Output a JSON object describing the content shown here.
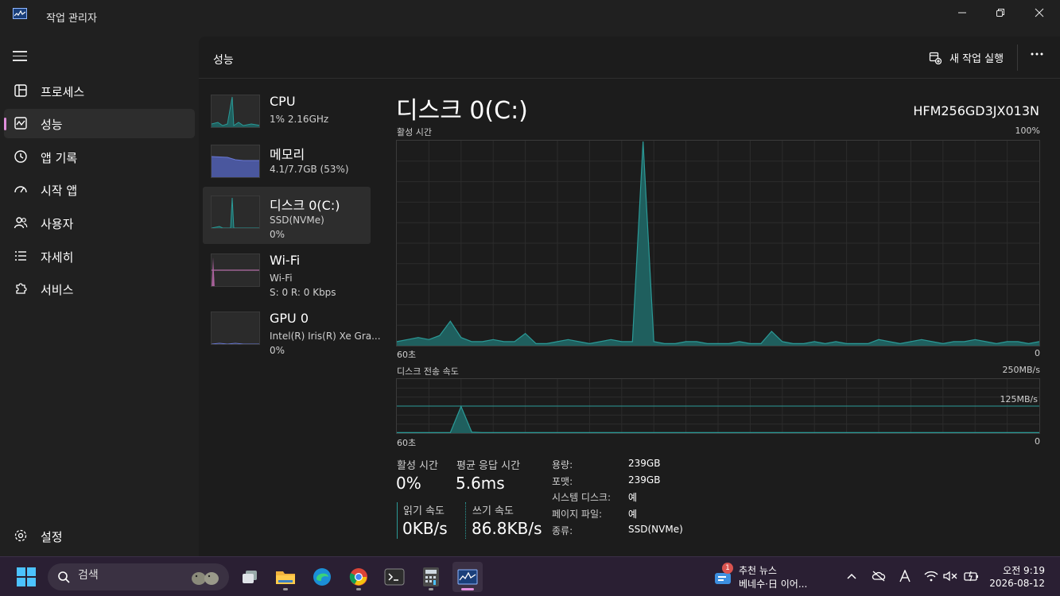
{
  "window": {
    "title": "작업 관리자"
  },
  "sidebar": {
    "items": [
      {
        "label": "프로세스",
        "icon": "grid-icon"
      },
      {
        "label": "성능",
        "icon": "pulse-icon"
      },
      {
        "label": "앱 기록",
        "icon": "history-icon"
      },
      {
        "label": "시작 앱",
        "icon": "speedometer-icon"
      },
      {
        "label": "사용자",
        "icon": "users-icon"
      },
      {
        "label": "자세히",
        "icon": "list-icon"
      },
      {
        "label": "서비스",
        "icon": "puzzle-icon"
      }
    ],
    "settings_label": "설정"
  },
  "header": {
    "title": "성능",
    "new_task_label": "새 작업 실행"
  },
  "devices": [
    {
      "name": "CPU",
      "sub1": "1% 2.16GHz",
      "sub2": "",
      "color": "#2b9a97"
    },
    {
      "name": "메모리",
      "sub1": "4.1/7.7GB (53%)",
      "sub2": "",
      "color": "#6a79d6"
    },
    {
      "name": "디스크 0(C:)",
      "sub1": "SSD(NVMe)",
      "sub2": "0%",
      "color": "#2b9a97"
    },
    {
      "name": "Wi-Fi",
      "sub1": "Wi-Fi",
      "sub2": "S: 0 R: 0 Kbps",
      "color": "#d67fc4"
    },
    {
      "name": "GPU 0",
      "sub1": "Intel(R) Iris(R) Xe Gra...",
      "sub2": "0%",
      "color": "#6a79d6"
    }
  ],
  "detail": {
    "title": "디스크 0(C:)",
    "model": "HFM256GD3JX013N",
    "active_time_graph": {
      "label": "활성 시간",
      "max_label": "100%",
      "x_left": "60초",
      "x_right": "0",
      "values": [
        2,
        3,
        4,
        3,
        5,
        12,
        4,
        2,
        2,
        3,
        2,
        2,
        6,
        1,
        1,
        2,
        3,
        2,
        1,
        2,
        3,
        2,
        2,
        100,
        2,
        1,
        1,
        2,
        2,
        1,
        1,
        1,
        2,
        1,
        1,
        7,
        2,
        1,
        1,
        2,
        1,
        2,
        1,
        1,
        1,
        3,
        2,
        1,
        2,
        3,
        2,
        1,
        2,
        2,
        3,
        2,
        1,
        2,
        2,
        1,
        2
      ]
    },
    "transfer_graph": {
      "label": "디스크 전송 속도",
      "max_label": "250MB/s",
      "mid_label": "125MB/s",
      "x_left": "60초",
      "x_right": "0",
      "values": [
        1,
        1,
        1,
        1,
        1,
        1,
        60,
        2,
        1,
        1,
        1,
        1,
        1,
        1,
        1,
        1,
        1,
        1,
        1,
        1,
        1,
        1,
        1,
        1,
        1,
        1,
        1,
        1,
        1,
        1,
        1,
        1,
        1,
        1,
        1,
        1,
        1,
        1,
        1,
        1,
        1,
        1,
        1,
        1,
        1,
        1,
        1,
        1,
        1,
        1,
        1,
        1,
        1,
        1,
        1,
        1,
        1,
        1,
        1,
        1,
        1
      ]
    },
    "stats": {
      "active_time_label": "활성 시간",
      "active_time_value": "0%",
      "avg_response_label": "평균 응답 시간",
      "avg_response_value": "5.6ms",
      "read_label": "읽기 속도",
      "read_value": "0KB/s",
      "write_label": "쓰기 속도",
      "write_value": "86.8KB/s"
    },
    "properties": [
      {
        "key": "용량:",
        "value": "239GB"
      },
      {
        "key": "포맷:",
        "value": "239GB"
      },
      {
        "key": "시스템 디스크:",
        "value": "예"
      },
      {
        "key": "페이지 파일:",
        "value": "예"
      },
      {
        "key": "종류:",
        "value": "SSD(NVMe)"
      }
    ]
  },
  "taskbar": {
    "search_placeholder": "검색",
    "news_title": "추천 뉴스",
    "news_subtitle": "베네수·日 이어...",
    "news_badge": "1",
    "time": "오전 9:19",
    "date": "2026-08-12"
  },
  "colors": {
    "accent": "#2b9a97",
    "nav_indicator": "#e08edc"
  }
}
